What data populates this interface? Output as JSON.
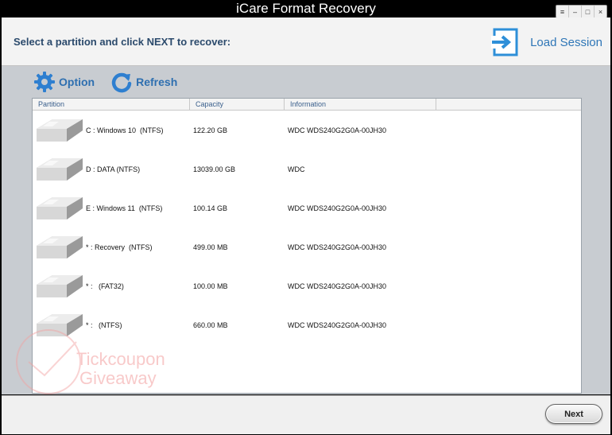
{
  "window": {
    "title": "iCare Format Recovery",
    "controls": [
      "≡",
      "–",
      "□",
      "×"
    ]
  },
  "header": {
    "instruction": "Select a partition and click NEXT to recover:",
    "load_session_label": "Load Session"
  },
  "toolbar": {
    "option_label": "Option",
    "refresh_label": "Refresh"
  },
  "table": {
    "columns": [
      "Partition",
      "Capacity",
      "Information"
    ],
    "rows": [
      {
        "partition": "C : Windows 10  (NTFS)",
        "capacity": "122.20 GB",
        "information": "WDC WDS240G2G0A-00JH30"
      },
      {
        "partition": "D : DATA (NTFS)",
        "capacity": "13039.00 GB",
        "information": "WDC"
      },
      {
        "partition": "E : Windows 11  (NTFS)",
        "capacity": "100.14 GB",
        "information": "WDC WDS240G2G0A-00JH30"
      },
      {
        "partition": "* : Recovery  (NTFS)",
        "capacity": "499.00 MB",
        "information": "WDC WDS240G2G0A-00JH30"
      },
      {
        "partition": "* :   (FAT32)",
        "capacity": "100.00 MB",
        "information": "WDC WDS240G2G0A-00JH30"
      },
      {
        "partition": "* :   (NTFS)",
        "capacity": "660.00 MB",
        "information": "WDC WDS240G2G0A-00JH30"
      }
    ]
  },
  "watermark": {
    "line1": "Tickcoupon",
    "line2": "Giveaway"
  },
  "footer": {
    "next_label": "Next"
  },
  "colors": {
    "title_bg": "#000000",
    "accent_blue": "#2e76b7",
    "header_text": "#2b4a6c",
    "content_bg": "#c8ccd1"
  }
}
